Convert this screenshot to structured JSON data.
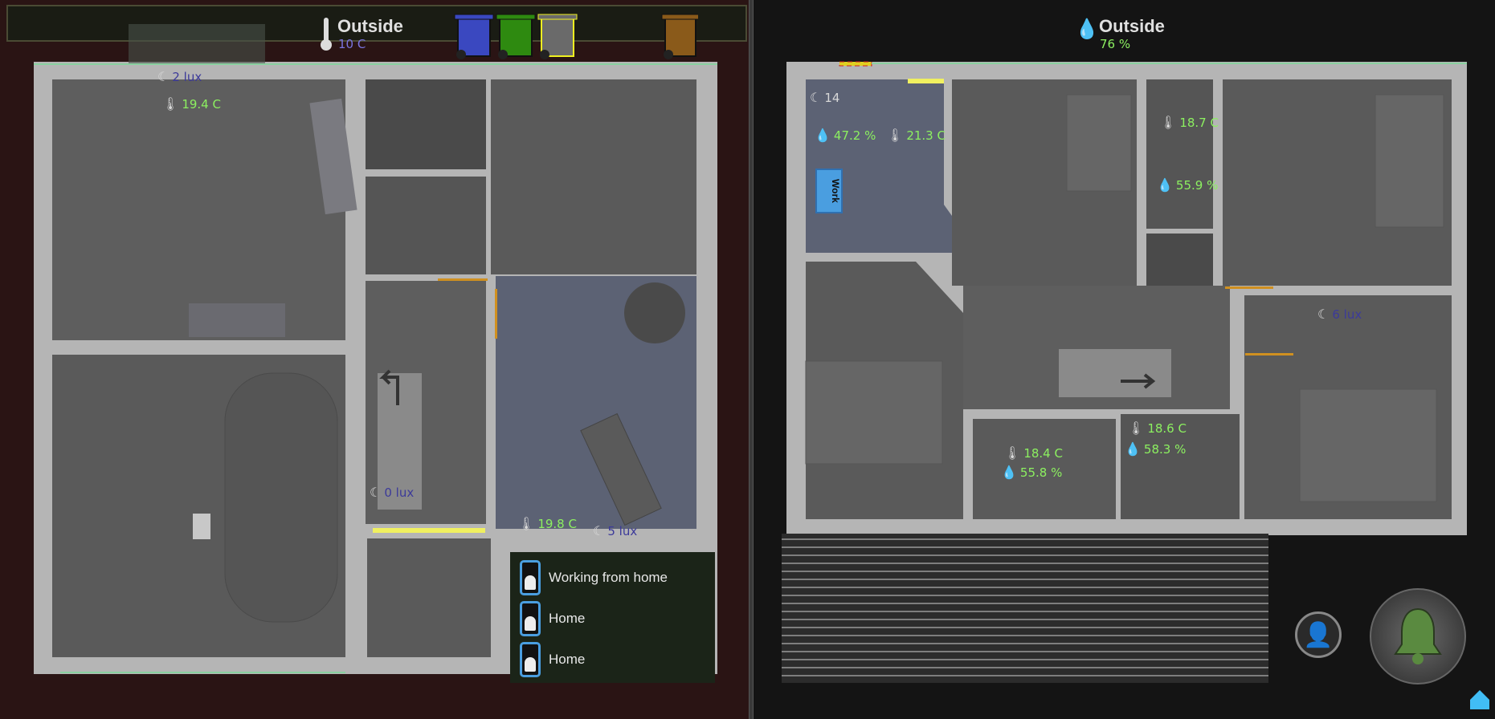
{
  "left_floor": {
    "outside": {
      "title": "Outside",
      "temperature": "10 C",
      "icon": "thermometer-icon"
    },
    "bins": [
      {
        "name": "blue-bin",
        "color": "#3a48c0"
      },
      {
        "name": "green-bin",
        "color": "#2e8a10"
      },
      {
        "name": "yellow-bin",
        "color": "#6a6a6a",
        "outline": "#f0f020"
      },
      {
        "name": "brown-bin",
        "color": "#8a5a1a"
      }
    ],
    "sensors": {
      "living_lux": "2 lux",
      "living_temp": "19.4 C",
      "hall_lux": "0 lux",
      "dining_temp": "19.8 C",
      "dining_lux": "5 lux"
    },
    "presence": [
      {
        "status": "Working from home",
        "gender": "male"
      },
      {
        "status": "Home",
        "gender": "female"
      },
      {
        "status": "Home",
        "gender": "male"
      }
    ]
  },
  "right_floor": {
    "outside": {
      "title": "Outside",
      "humidity": "76 %",
      "icon": "humidity-icon"
    },
    "sensors": {
      "office_lux": "14",
      "office_humidity": "47.2 %",
      "office_temp": "21.3 C",
      "bath1_temp": "18.7 C",
      "bath1_humidity": "55.9 %",
      "bedroom_lux": "6 lux",
      "bath2_temp": "18.4 C",
      "bath2_humidity": "55.8 %",
      "wc_temp": "18.6 C",
      "wc_humidity": "58.3 %"
    },
    "office_sign": "Work"
  },
  "colors": {
    "wall": "#b5b5b5",
    "floor": "#5e5e5e",
    "blue_room": "#5c6274",
    "accent_green": "#8cf060",
    "light_yellow": "#f0f060",
    "door_orange": "#d09020"
  }
}
